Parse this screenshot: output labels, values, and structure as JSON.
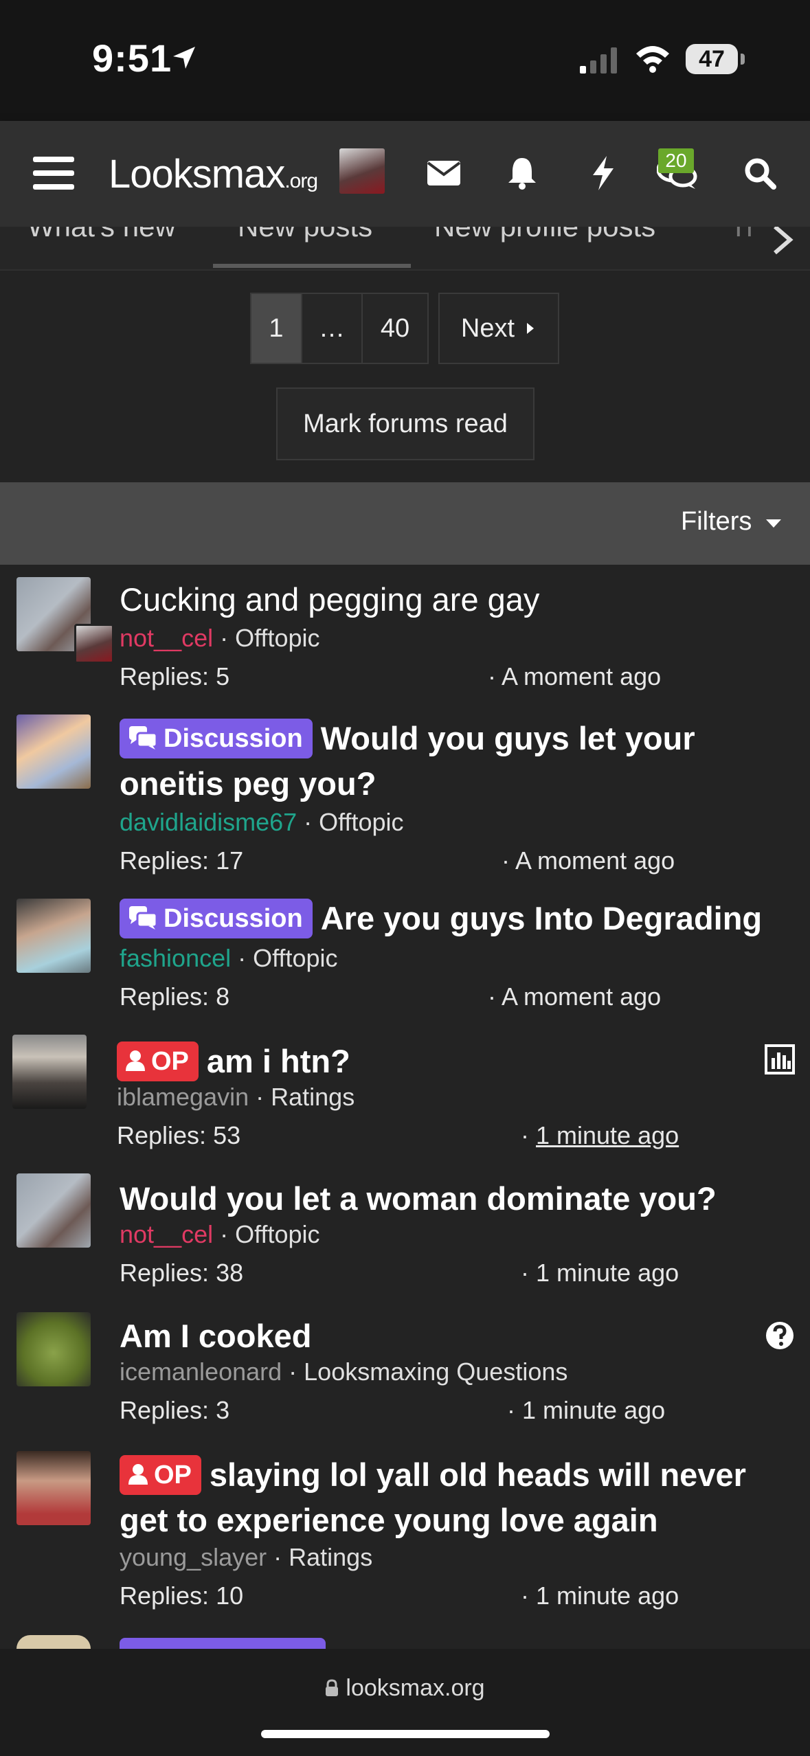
{
  "status": {
    "time": "9:51",
    "battery": "47"
  },
  "nav": {
    "logo_main": "Looksmax",
    "logo_suffix": ".org",
    "chat_badge": "20"
  },
  "tabs": [
    "What's new",
    "New posts",
    "New profile posts",
    "Tr"
  ],
  "pagination": {
    "current": "1",
    "ellipsis": "…",
    "last": "40",
    "next": "Next"
  },
  "mark_read": "Mark forums read",
  "filters": "Filters",
  "threads": [
    {
      "title": "Cucking and pegging are gay",
      "label": "",
      "user": "not__cel",
      "forum": "Offtopic",
      "replies": "Replies: 5",
      "time": "A moment ago"
    },
    {
      "title": "Would you guys let your oneitis peg you?",
      "label": "Discussion",
      "user": "davidlaidisme67",
      "forum": "Offtopic",
      "replies": "Replies: 17",
      "time": "A moment ago"
    },
    {
      "title": "Are you guys Into Degrading",
      "label": "Discussion",
      "user": "fashioncel",
      "forum": "Offtopic",
      "replies": "Replies: 8",
      "time": "A moment ago"
    },
    {
      "title": "am i htn?",
      "label": "OP",
      "user": "iblamegavin",
      "forum": "Ratings",
      "replies": "Replies: 53",
      "time": "1 minute ago"
    },
    {
      "title": "Would you let a woman dominate you?",
      "label": "",
      "user": "not__cel",
      "forum": "Offtopic",
      "replies": "Replies: 38",
      "time": "1 minute ago"
    },
    {
      "title": "Am I cooked",
      "label": "",
      "user": "icemanleonard",
      "forum": "Looksmaxing Questions",
      "replies": "Replies: 3",
      "time": "1 minute ago"
    },
    {
      "title": "slaying lol yall old heads will never get to experience young love again",
      "label": "OP",
      "user": "young_slayer",
      "forum": "Ratings",
      "replies": "Replies: 10",
      "time": "1 minute ago"
    }
  ],
  "url": "looksmax.org"
}
